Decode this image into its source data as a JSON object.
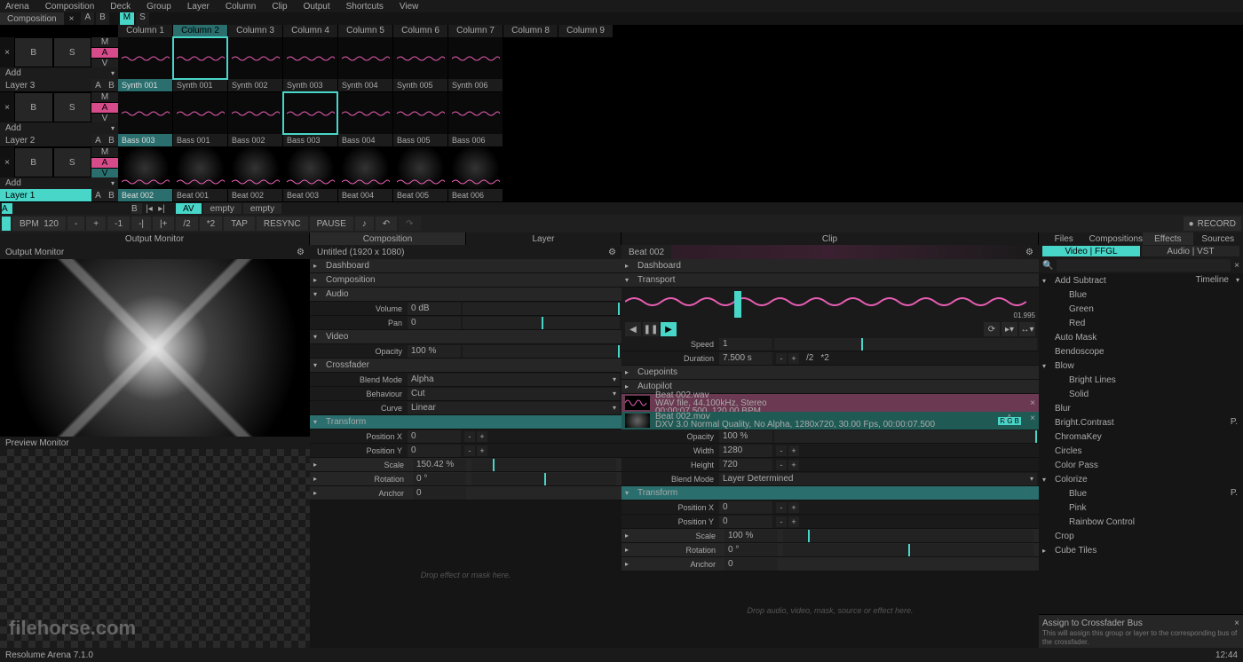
{
  "menu": [
    "Arena",
    "Composition",
    "Deck",
    "Group",
    "Layer",
    "Column",
    "Clip",
    "Output",
    "Shortcuts",
    "View"
  ],
  "deck": {
    "composition": "Composition",
    "close": "×",
    "a": "A",
    "b": "B",
    "m": "M",
    "s": "S"
  },
  "columns": [
    "Column 1",
    "Column 2",
    "Column 3",
    "Column 4",
    "Column 5",
    "Column 6",
    "Column 7",
    "Column 8",
    "Column 9"
  ],
  "col_selected": 1,
  "layers": [
    {
      "name": "Layer 3",
      "active": false,
      "b": "B",
      "s": "S",
      "add": "Add",
      "clips": [
        "Synth 001",
        "Synth 001",
        "Synth 002",
        "Synth 003",
        "Synth 004",
        "Synth 005",
        "Synth 006"
      ],
      "sel": 1,
      "type": "wave"
    },
    {
      "name": "Layer 2",
      "active": false,
      "b": "B",
      "s": "S",
      "add": "Add",
      "clips": [
        "Bass 003",
        "Bass 001",
        "Bass 002",
        "Bass 003",
        "Bass 004",
        "Bass 005",
        "Bass 006"
      ],
      "sel": 3,
      "type": "wave"
    },
    {
      "name": "Layer 1",
      "active": true,
      "b": "B",
      "s": "S",
      "add": "Add",
      "clips": [
        "Beat 002",
        "Beat 001",
        "Beat 002",
        "Beat 003",
        "Beat 004",
        "Beat 005",
        "Beat 006"
      ],
      "sel": -1,
      "type": "vid"
    }
  ],
  "xrow": {
    "a": "A",
    "b": "B",
    "pills": [
      "AV",
      "empty",
      "empty"
    ]
  },
  "bpm": {
    "label": "BPM",
    "value": "120",
    "buttons": [
      "-",
      "+",
      "-1",
      "-|",
      "|+",
      "/2",
      "*2",
      "TAP",
      "RESYNC",
      "PAUSE"
    ],
    "record": "RECORD"
  },
  "mid_tabs": {
    "output": "Output Monitor",
    "composition": "Composition",
    "layer": "Layer",
    "clip": "Clip"
  },
  "output": {
    "title": "Output Monitor",
    "preview": "Preview Monitor",
    "watermark": "filehorse.com"
  },
  "comp": {
    "title": "Untitled (1920 x 1080)",
    "sections": {
      "dashboard": "Dashboard",
      "composition": "Composition",
      "audio": "Audio",
      "video": "Video",
      "crossfader": "Crossfader",
      "transform": "Transform",
      "scale": "Scale",
      "rotation": "Rotation",
      "anchor": "Anchor"
    },
    "rows": {
      "volume": {
        "label": "Volume",
        "val": "0 dB"
      },
      "pan": {
        "label": "Pan",
        "val": "0"
      },
      "opacity": {
        "label": "Opacity",
        "val": "100 %"
      },
      "blendmode": {
        "label": "Blend Mode",
        "val": "Alpha"
      },
      "behaviour": {
        "label": "Behaviour",
        "val": "Cut"
      },
      "curve": {
        "label": "Curve",
        "val": "Linear"
      },
      "posx": {
        "label": "Position X",
        "val": "0"
      },
      "posy": {
        "label": "Position Y",
        "val": "0"
      },
      "scale": {
        "label": "Scale",
        "val": "150.42 %"
      },
      "rotation": {
        "label": "Rotation",
        "val": "0 °"
      },
      "anchor": {
        "label": "Anchor",
        "val": "0"
      }
    },
    "drop": "Drop effect or mask here."
  },
  "clip": {
    "title": "Beat 002",
    "sections": {
      "dashboard": "Dashboard",
      "transport": "Transport",
      "cuepoints": "Cuepoints",
      "autopilot": "Autopilot",
      "transform": "Transform",
      "scale": "Scale",
      "rotation": "Rotation",
      "anchor": "Anchor"
    },
    "transport": {
      "timeline": "Timeline",
      "time": "01.995"
    },
    "rows": {
      "speed": {
        "label": "Speed",
        "val": "1"
      },
      "duration": {
        "label": "Duration",
        "val": "7.500 s",
        "extra": [
          "/2",
          "*2"
        ]
      },
      "opacity": {
        "label": "Opacity",
        "val": "100 %"
      },
      "width": {
        "label": "Width",
        "val": "1280"
      },
      "height": {
        "label": "Height",
        "val": "720"
      },
      "blendmode": {
        "label": "Blend Mode",
        "val": "Layer Determined"
      },
      "posx": {
        "label": "Position X",
        "val": "0"
      },
      "posy": {
        "label": "Position Y",
        "val": "0"
      },
      "scale": {
        "label": "Scale",
        "val": "100 %"
      },
      "rotation": {
        "label": "Rotation",
        "val": "0 °"
      },
      "anchor": {
        "label": "Anchor",
        "val": "0"
      }
    },
    "audio": {
      "name": "Beat 002.wav",
      "info": "WAV file, 44.100kHz, Stereo",
      "dur": "00:00:07.500, 120.00 BPM"
    },
    "video": {
      "name": "Beat 002.mov",
      "info": "DXV 3.0 Normal Quality, No Alpha, 1280x720, 30.00 Fps, 00:00:07.500",
      "rgb": "R G B"
    },
    "drop": "Drop audio, video, mask, source or effect here."
  },
  "fx": {
    "tabs": [
      "Files",
      "Compositions",
      "Effects",
      "Sources"
    ],
    "subtabs": [
      "Video | FFGL",
      "Audio | VST"
    ],
    "search_ph": "",
    "list": [
      {
        "name": "Add Subtract",
        "exp": true
      },
      {
        "name": "Blue",
        "sub": true
      },
      {
        "name": "Green",
        "sub": true
      },
      {
        "name": "Red",
        "sub": true
      },
      {
        "name": "Auto Mask"
      },
      {
        "name": "Bendoscope"
      },
      {
        "name": "Blow",
        "exp": true
      },
      {
        "name": "Bright Lines",
        "sub": true
      },
      {
        "name": "Solid",
        "sub": true
      },
      {
        "name": "Blur"
      },
      {
        "name": "Bright.Contrast"
      },
      {
        "name": "ChromaKey"
      },
      {
        "name": "Circles"
      },
      {
        "name": "Color Pass"
      },
      {
        "name": "Colorize",
        "exp": true
      },
      {
        "name": "Blue",
        "sub": true
      },
      {
        "name": "Pink",
        "sub": true
      },
      {
        "name": "Rainbow Control",
        "sub": true
      },
      {
        "name": "Crop"
      },
      {
        "name": "Cube Tiles",
        "exp": false
      }
    ],
    "assign": {
      "title": "Assign to Crossfader Bus",
      "desc": "This will assign this group or layer to the corresponding bus of the crossfader."
    }
  },
  "status": {
    "app": "Resolume Arena 7.1.0",
    "time": "12:44"
  }
}
